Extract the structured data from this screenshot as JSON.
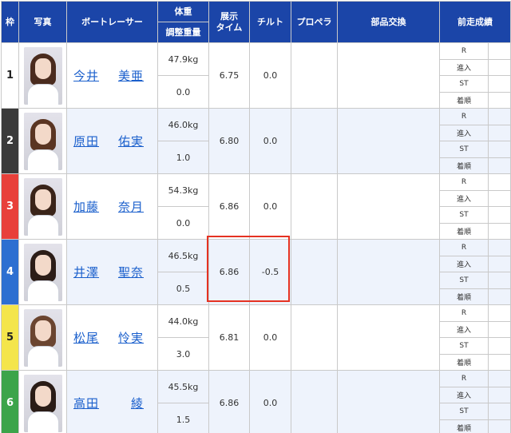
{
  "headers": {
    "waku": "枠",
    "photo": "写真",
    "racer": "ボートレーサー",
    "weight": "体重",
    "adjust": "調整重量",
    "tenji": "展示\nタイム",
    "tilt": "チルト",
    "propeller": "プロペラ",
    "parts": "部品交換",
    "prev": "前走成績"
  },
  "zen_labels": [
    "R",
    "進入",
    "ST",
    "着順"
  ],
  "colors": {
    "header_bg": "#1b45a8",
    "link": "#1a5fcc",
    "highlight": "#e53222"
  },
  "racers": [
    {
      "waku": "1",
      "color": "#ffffff",
      "text_color": "#222222",
      "name_family": "今井",
      "name_given": "美亜",
      "weight": "47.9kg",
      "adjust": "0.0",
      "tenji": "6.75",
      "tilt": "0.0",
      "hair": "#4a2b1e"
    },
    {
      "waku": "2",
      "color": "#3a3a3a",
      "text_color": "#ffffff",
      "name_family": "原田",
      "name_given": "佑実",
      "weight": "46.0kg",
      "adjust": "1.0",
      "tenji": "6.80",
      "tilt": "0.0",
      "hair": "#5a3522"
    },
    {
      "waku": "3",
      "color": "#e8403a",
      "text_color": "#ffffff",
      "name_family": "加藤",
      "name_given": "奈月",
      "weight": "54.3kg",
      "adjust": "0.0",
      "tenji": "6.86",
      "tilt": "0.0",
      "hair": "#3a2419"
    },
    {
      "waku": "4",
      "color": "#2d6fd1",
      "text_color": "#ffffff",
      "name_family": "井澤",
      "name_given": "聖奈",
      "weight": "46.5kg",
      "adjust": "0.5",
      "tenji": "6.86",
      "tilt": "-0.5",
      "hair": "#2c1d17"
    },
    {
      "waku": "5",
      "color": "#f4e54b",
      "text_color": "#222222",
      "name_family": "松尾",
      "name_given": "怜実",
      "weight": "44.0kg",
      "adjust": "3.0",
      "tenji": "6.81",
      "tilt": "0.0",
      "hair": "#6b4530"
    },
    {
      "waku": "6",
      "color": "#3ca44a",
      "text_color": "#ffffff",
      "name_family": "高田",
      "name_given": "綾",
      "weight": "45.5kg",
      "adjust": "1.5",
      "tenji": "6.86",
      "tilt": "0.0",
      "hair": "#2a1c16"
    }
  ]
}
